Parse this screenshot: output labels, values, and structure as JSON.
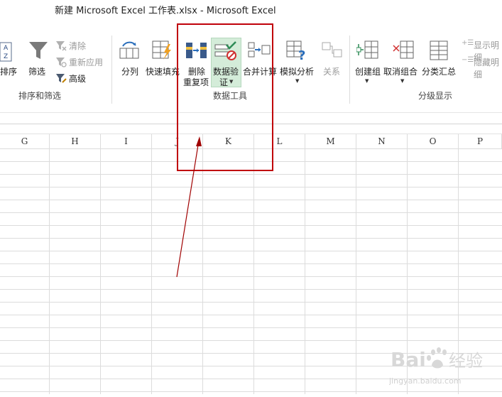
{
  "window": {
    "title": "新建 Microsoft Excel 工作表.xlsx - Microsoft Excel"
  },
  "ribbon": {
    "sort_filter": {
      "sort_label": "排序",
      "filter_label": "筛选",
      "clear_label": "清除",
      "reapply_label": "重新应用",
      "advanced_label": "高级",
      "group_label": "排序和筛选"
    },
    "data_tools": {
      "text_to_columns_label": "分列",
      "flash_fill_label": "快速填充",
      "remove_duplicates_label_1": "删除",
      "remove_duplicates_label_2": "重复项",
      "data_validation_label_1": "数据验",
      "data_validation_label_2": "证",
      "consolidate_label": "合并计算",
      "what_if_label": "模拟分析",
      "relationships_label": "关系",
      "group_label": "数据工具"
    },
    "outline": {
      "group_label_btn": "创建组",
      "ungroup_label": "取消组合",
      "subtotal_label": "分类汇总",
      "show_detail_label": "显示明细",
      "hide_detail_label": "隐藏明细",
      "group_label": "分级显示"
    }
  },
  "sheet": {
    "columns": [
      "G",
      "H",
      "I",
      "J",
      "K",
      "L",
      "M",
      "N",
      "O",
      "P"
    ]
  },
  "watermark": {
    "line1": "Bai",
    "line2": "经验",
    "line3": "jingyan.baidu.com"
  },
  "colors": {
    "highlight": "#c0000a",
    "accent": "#217346",
    "selected_btn": "#d4ecd9"
  }
}
